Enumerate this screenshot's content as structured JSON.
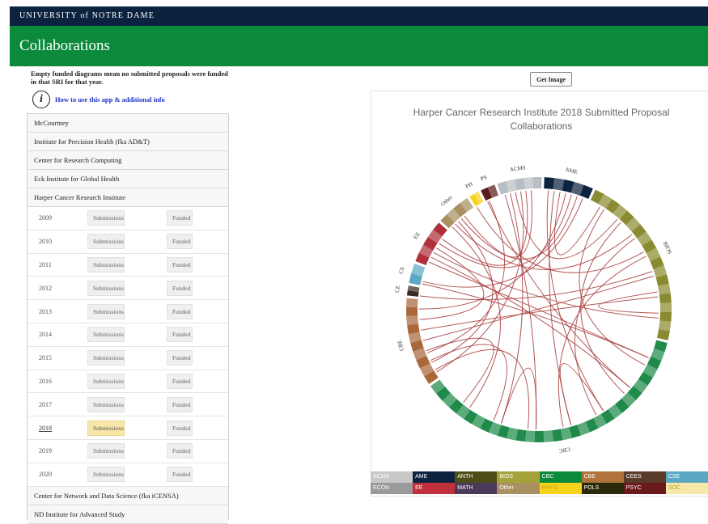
{
  "header": {
    "brand": "UNIVERSITY of NOTRE DAME",
    "page_title": "Collaborations"
  },
  "notice": "Empty funded diagrams mean no submitted proposals were funded in that SRI for that year.",
  "help_link": "How to use this app & additional info",
  "institutes_top": [
    "McCourtney",
    "Institute for Precision Health (fka AD&T)",
    "Center for Research Computing",
    "Eck Institute for Global Health",
    "Harper Cancer Research Institute"
  ],
  "years": [
    {
      "year": "2009",
      "submissions": "Submissions",
      "funded": "Funded"
    },
    {
      "year": "2010",
      "submissions": "Submissions",
      "funded": "Funded"
    },
    {
      "year": "2011",
      "submissions": "Submissions",
      "funded": "Funded"
    },
    {
      "year": "2012",
      "submissions": "Submissions",
      "funded": "Funded"
    },
    {
      "year": "2013",
      "submissions": "Submissions",
      "funded": "Funded"
    },
    {
      "year": "2014",
      "submissions": "Submissions",
      "funded": "Funded"
    },
    {
      "year": "2015",
      "submissions": "Submissions",
      "funded": "Funded"
    },
    {
      "year": "2016",
      "submissions": "Submissions",
      "funded": "Funded"
    },
    {
      "year": "2017",
      "submissions": "Submissions",
      "funded": "Funded"
    },
    {
      "year": "2018",
      "submissions": "Submissions",
      "funded": "Funded",
      "selected": true
    },
    {
      "year": "2019",
      "submissions": "Submissions",
      "funded": "Funded"
    },
    {
      "year": "2020",
      "submissions": "Submissions",
      "funded": "Funded"
    }
  ],
  "institutes_bottom": [
    "Center for Network and Data Science (fka iCENSA)",
    "ND Institute for Advanced Study"
  ],
  "get_image_label": "Get Image",
  "chart_title_line1": "Harper Cancer Research Institute 2018 Submitted Proposal",
  "chart_title_line2": "Collaborations",
  "legend": [
    {
      "label": "ACMS",
      "color": "#c8c8c8"
    },
    {
      "label": "AME",
      "color": "#0c2340"
    },
    {
      "label": "ANTH",
      "color": "#4d4d1a"
    },
    {
      "label": "BIOS",
      "color": "#a4a339"
    },
    {
      "label": "CBC",
      "color": "#0c8a3c"
    },
    {
      "label": "CBE",
      "color": "#b0733a"
    },
    {
      "label": "CEES",
      "color": "#5a3a2a"
    },
    {
      "label": "CSE",
      "color": "#5ba8c4"
    },
    {
      "label": "ECON",
      "color": "#9a9a9a"
    },
    {
      "label": "EE",
      "color": "#c0303a"
    },
    {
      "label": "MATH",
      "color": "#4a3a5a"
    },
    {
      "label": "Other",
      "color": "#a89060"
    },
    {
      "label": "PHYS",
      "color": "#f6d21a"
    },
    {
      "label": "POLS",
      "color": "#2a2a0a"
    },
    {
      "label": "PSYC",
      "color": "#6a1a1a"
    },
    {
      "label": "SOC",
      "color": "#f6e8a8"
    }
  ],
  "chart_data": {
    "type": "chord",
    "title": "Harper Cancer Research Institute 2018 Submitted Proposal Collaborations",
    "groups": [
      {
        "name": "ACMS",
        "size": 9,
        "color": "#b8bcc4"
      },
      {
        "name": "AME",
        "size": 10,
        "color": "#0c2340"
      },
      {
        "name": "BIOS",
        "size": 36,
        "color": "#8a8a30"
      },
      {
        "name": "CBC",
        "size": 60,
        "color": "#1f8a4a"
      },
      {
        "name": "CBE",
        "size": 18,
        "color": "#a9683a"
      },
      {
        "name": "CE",
        "size": 2,
        "color": "#3a2a22"
      },
      {
        "name": "CS",
        "size": 4,
        "color": "#5ba8c4"
      },
      {
        "name": "EE",
        "size": 9,
        "color": "#b0303a"
      },
      {
        "name": "Other",
        "size": 7,
        "color": "#a89060"
      },
      {
        "name": "PH",
        "size": 2,
        "color": "#f6d21a"
      },
      {
        "name": "PS",
        "size": 3,
        "color": "#5a1a1a"
      }
    ],
    "chord_color": "#a83a3a",
    "chords": [
      [
        "CBC",
        "BIOS"
      ],
      [
        "CBC",
        "BIOS"
      ],
      [
        "CBC",
        "BIOS"
      ],
      [
        "CBC",
        "BIOS"
      ],
      [
        "CBC",
        "CBE"
      ],
      [
        "CBC",
        "CBE"
      ],
      [
        "CBC",
        "CBE"
      ],
      [
        "CBC",
        "EE"
      ],
      [
        "CBC",
        "EE"
      ],
      [
        "CBC",
        "AME"
      ],
      [
        "CBC",
        "AME"
      ],
      [
        "CBC",
        "ACMS"
      ],
      [
        "CBC",
        "ACMS"
      ],
      [
        "CBC",
        "Other"
      ],
      [
        "CBC",
        "CS"
      ],
      [
        "CBC",
        "PS"
      ],
      [
        "CBC",
        "CBC"
      ],
      [
        "CBC",
        "CBC"
      ],
      [
        "BIOS",
        "CBE"
      ],
      [
        "BIOS",
        "CBE"
      ],
      [
        "BIOS",
        "EE"
      ],
      [
        "BIOS",
        "AME"
      ],
      [
        "BIOS",
        "ACMS"
      ],
      [
        "BIOS",
        "Other"
      ],
      [
        "BIOS",
        "PH"
      ],
      [
        "BIOS",
        "CE"
      ],
      [
        "BIOS",
        "BIOS"
      ],
      [
        "CBE",
        "EE"
      ],
      [
        "CBE",
        "AME"
      ],
      [
        "CBE",
        "ACMS"
      ],
      [
        "CBE",
        "Other"
      ],
      [
        "EE",
        "AME"
      ],
      [
        "EE",
        "ACMS"
      ],
      [
        "AME",
        "Other"
      ],
      [
        "ACMS",
        "Other"
      ],
      [
        "CS",
        "AME"
      ],
      [
        "PS",
        "CBE"
      ]
    ]
  }
}
